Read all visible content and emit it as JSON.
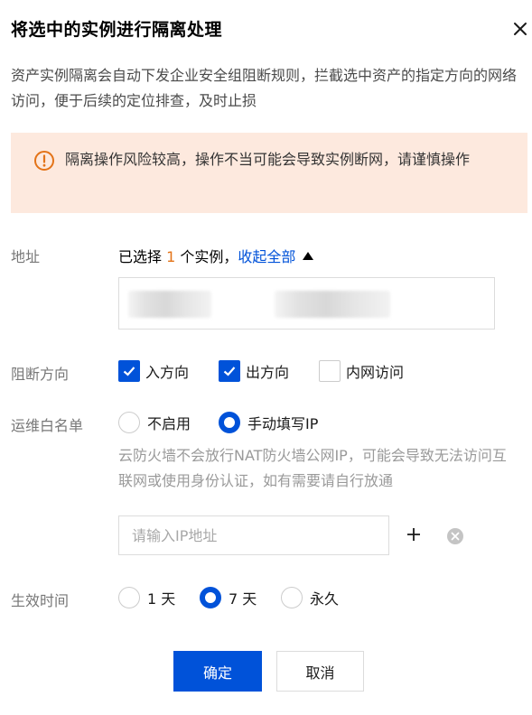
{
  "dialog": {
    "title": "将选中的实例进行隔离处理",
    "description": "资产实例隔离会自动下发企业安全组阻断规则，拦截选中资产的指定方向的网络访问，便于后续的定位排查，及时止损"
  },
  "alert": {
    "text": "隔离操作风险较高，操作不当可能会导致实例断网，请谨慎操作",
    "color": "#fde9de",
    "icon": "warning-circle-icon"
  },
  "address": {
    "label": "地址",
    "selected_prefix": "已选择",
    "selected_count": "1",
    "selected_suffix": "个实例，",
    "collapse_link": "收起全部"
  },
  "direction": {
    "label": "阻断方向",
    "options": [
      {
        "label": "入方向",
        "checked": true
      },
      {
        "label": "出方向",
        "checked": true
      },
      {
        "label": "内网访问",
        "checked": false
      }
    ]
  },
  "whitelist": {
    "label": "运维白名单",
    "options": [
      {
        "label": "不启用",
        "selected": false
      },
      {
        "label": "手动填写IP",
        "selected": true
      }
    ],
    "hint": "云防火墙不会放行NAT防火墙公网IP，可能会导致无法访问互联网或使用身份认证，如有需要请自行放通",
    "ip_placeholder": "请输入IP地址",
    "ip_value": ""
  },
  "duration": {
    "label": "生效时间",
    "options": [
      {
        "label": "1 天",
        "selected": false
      },
      {
        "label": "7 天",
        "selected": true
      },
      {
        "label": "永久",
        "selected": false
      }
    ]
  },
  "buttons": {
    "confirm": "确定",
    "cancel": "取消"
  },
  "colors": {
    "primary": "#0052d9",
    "warning_accent": "#e37318",
    "alert_bg": "#fde9de"
  }
}
